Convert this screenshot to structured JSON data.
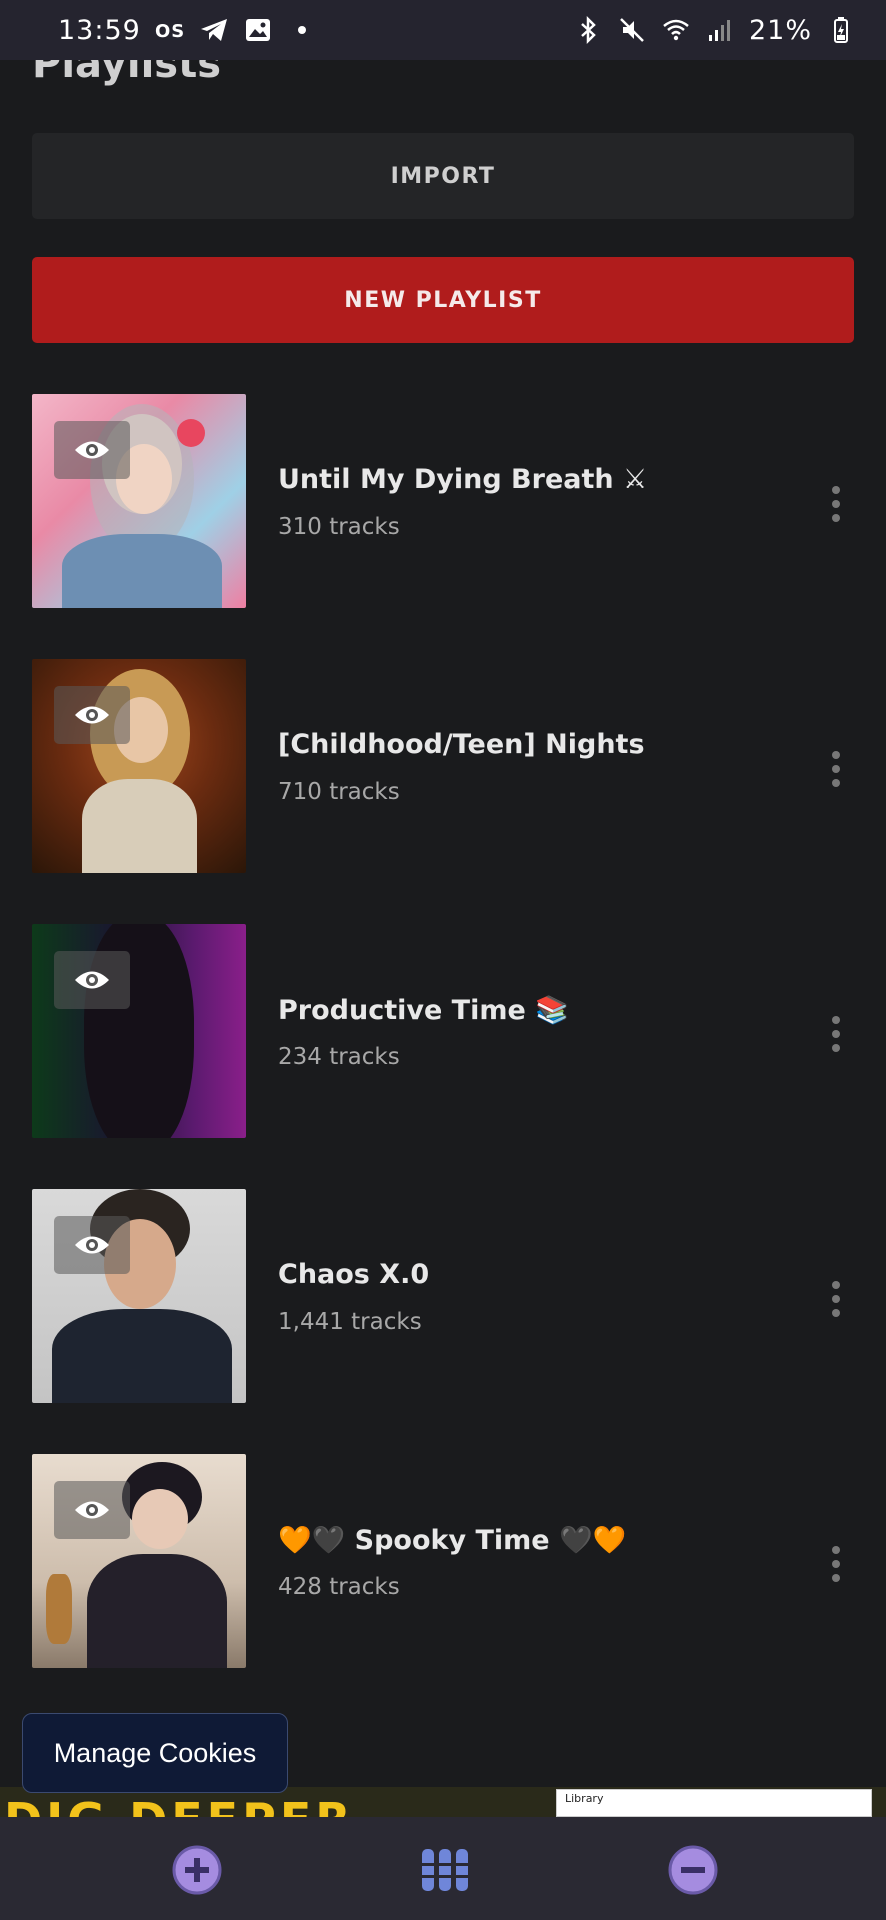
{
  "status_bar": {
    "time": "13:59",
    "left_icons": [
      "os-badge-icon",
      "telegram-icon",
      "gallery-icon",
      "dot-icon"
    ],
    "right_icons": [
      "bluetooth-icon",
      "mute-icon",
      "wifi-icon",
      "signal-icon"
    ],
    "battery": "21%"
  },
  "page": {
    "title": "Playlists"
  },
  "buttons": {
    "import": "IMPORT",
    "new_playlist": "NEW PLAYLIST"
  },
  "playlists": [
    {
      "name": "Until My Dying Breath ⚔",
      "count": "310 tracks"
    },
    {
      "name": "[Childhood/Teen] Nights",
      "count": "710 tracks"
    },
    {
      "name": "Productive Time 📚",
      "count": "234 tracks"
    },
    {
      "name": "Chaos X.0",
      "count": "1,441 tracks"
    },
    {
      "name": "🧡🖤 Spooky Time 🖤🧡",
      "count": "428 tracks"
    }
  ],
  "cookies": {
    "label": "Manage Cookies"
  },
  "ad": {
    "headline": "DIG DEEPER",
    "panel_label": "Library"
  },
  "bottom_nav": [
    "plus-circle-icon",
    "columns-icon",
    "minus-circle-icon"
  ]
}
